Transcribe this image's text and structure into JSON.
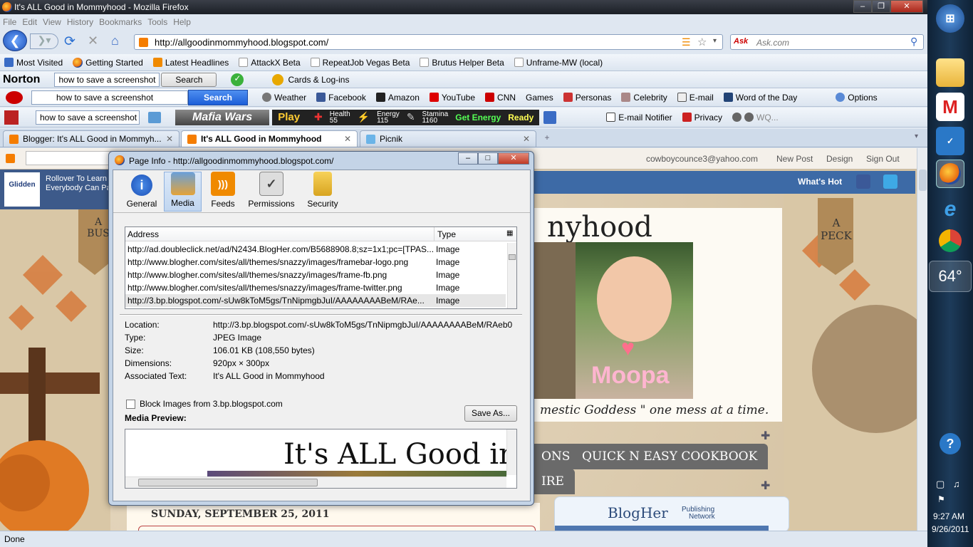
{
  "window": {
    "title": "It's ALL Good in Mommyhood - Mozilla Firefox"
  },
  "menu": [
    "File",
    "Edit",
    "View",
    "History",
    "Bookmarks",
    "Tools",
    "Help"
  ],
  "nav": {
    "url": "http://allgoodinmommyhood.blogspot.com/",
    "search_placeholder": "Ask.com"
  },
  "bookmarks": [
    "Most Visited",
    "Getting Started",
    "Latest Headlines",
    "AttackX Beta",
    "RepeatJob Vegas Beta",
    "Brutus Helper Beta",
    "Unframe-MW (local)"
  ],
  "norton": {
    "brand": "Norton",
    "search_value": "how to save a screenshot",
    "search_button": "Search",
    "cards": "Cards & Log-ins"
  },
  "ask_toolbar": {
    "search_value": "how to save a screenshot",
    "search_button": "Search",
    "items": [
      "Weather",
      "Facebook",
      "Amazon",
      "YouTube",
      "CNN",
      "Games",
      "Personas",
      "Celebrity",
      "E-mail",
      "Word of the Day"
    ],
    "options": "Options"
  },
  "mafia_toolbar": {
    "search_value": "how to save a screenshot",
    "game": "Mafia Wars",
    "play": "Play",
    "health_label": "Health",
    "health_value": "55",
    "energy_label": "Energy",
    "energy_value": "115",
    "stamina_label": "Stamina",
    "stamina_value": "1160",
    "get_energy": "Get Energy",
    "ready": "Ready",
    "email_notifier": "E-mail Notifier",
    "privacy": "Privacy",
    "player": "WQ..."
  },
  "tabs": [
    {
      "label": "Blogger: It's ALL Good in Mommyh..."
    },
    {
      "label": "It's ALL Good in Mommyhood"
    },
    {
      "label": "Picnik"
    }
  ],
  "blogger_bar": {
    "email": "cowboycounce3@yahoo.com",
    "new_post": "New Post",
    "design": "Design",
    "sign_out": "Sign Out"
  },
  "blog": {
    "whats_hot": "What's Hot",
    "ad_brand": "Glidden",
    "ad_text_1": "Rollover To Learn",
    "ad_text_2": "Everybody Can Pa",
    "header_text": "nyhood",
    "photo_caption": "Moopa",
    "tagline": "mestic Goddess \" one mess at a time.",
    "tab_1": "ONS",
    "tab_2": "QUICK N EASY COOKBOOK",
    "tab_3": "IRE",
    "date": "SUNDAY, SEPTEMBER 25, 2011",
    "blogher": "BlogHer",
    "blogher_sub_1": "Publishing",
    "blogher_sub_2": "Network",
    "tag_left": "A BUS",
    "tag_right": "A PECK"
  },
  "status": "Done",
  "dialog": {
    "title": "Page Info - http://allgoodinmommyhood.blogspot.com/",
    "tabs": [
      "General",
      "Media",
      "Feeds",
      "Permissions",
      "Security"
    ],
    "col_address": "Address",
    "col_type": "Type",
    "rows": [
      {
        "address": "http://ad.doubleclick.net/ad/N2434.BlogHer.com/B5688908.8;sz=1x1;pc=[TPAS...",
        "type": "Image"
      },
      {
        "address": "http://www.blogher.com/sites/all/themes/snazzy/images/framebar-logo.png",
        "type": "Image"
      },
      {
        "address": "http://www.blogher.com/sites/all/themes/snazzy/images/frame-fb.png",
        "type": "Image"
      },
      {
        "address": "http://www.blogher.com/sites/all/themes/snazzy/images/frame-twitter.png",
        "type": "Image"
      },
      {
        "address": "http://3.bp.blogspot.com/-sUw8kToM5gs/TnNipmgbJuI/AAAAAAAABeM/RAe...",
        "type": "Image"
      }
    ],
    "location_label": "Location:",
    "location_value": "http://3.bp.blogspot.com/-sUw8kToM5gs/TnNipmgbJuI/AAAAAAAABeM/RAeb0",
    "type_label": "Type:",
    "type_value": "JPEG Image",
    "size_label": "Size:",
    "size_value": "106.01 KB (108,550 bytes)",
    "dimensions_label": "Dimensions:",
    "dimensions_value": "920px × 300px",
    "assoc_label": "Associated Text:",
    "assoc_value": "It's ALL Good in Mommyhood",
    "block_label": "Block Images from 3.bp.blogspot.com",
    "save_as": "Save As...",
    "preview_label": "Media Preview:",
    "preview_text": "It's ALL Good in Mo"
  },
  "taskbar": {
    "temperature": "64°",
    "time": "9:27 AM",
    "date": "9/26/2011"
  }
}
